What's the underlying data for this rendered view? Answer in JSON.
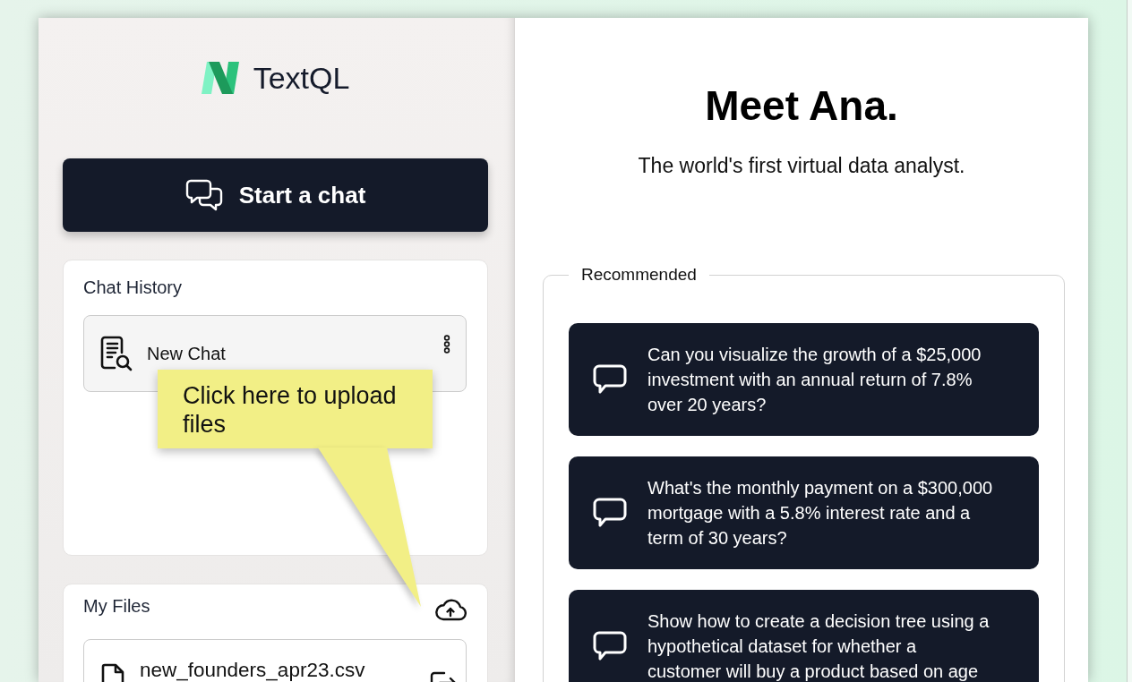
{
  "sidebar": {
    "logo": {
      "text": "TextQL"
    },
    "start_button": {
      "label": "Start a chat"
    },
    "chat_history": {
      "title": "Chat History",
      "items": [
        {
          "title": "New Chat"
        }
      ]
    },
    "my_files": {
      "title": "My Files",
      "files": [
        {
          "name": "new_founders_apr23.csv"
        }
      ]
    }
  },
  "callout": {
    "text": "Click here to upload files"
  },
  "main": {
    "title": "Meet Ana.",
    "subtitle": "The world's first virtual data analyst.",
    "recommended": {
      "title": "Recommended",
      "prompts": [
        {
          "text": "Can you visualize the growth of a $25,000 investment with an annual return of 7.8% over 20 years?"
        },
        {
          "text": "What's the monthly payment on a $300,000 mortgage with a 5.8% interest rate and a term of 30 years?"
        },
        {
          "text": "Show how to create a decision tree using a hypothetical dataset for whether a customer will buy a product based on age"
        }
      ]
    }
  }
}
